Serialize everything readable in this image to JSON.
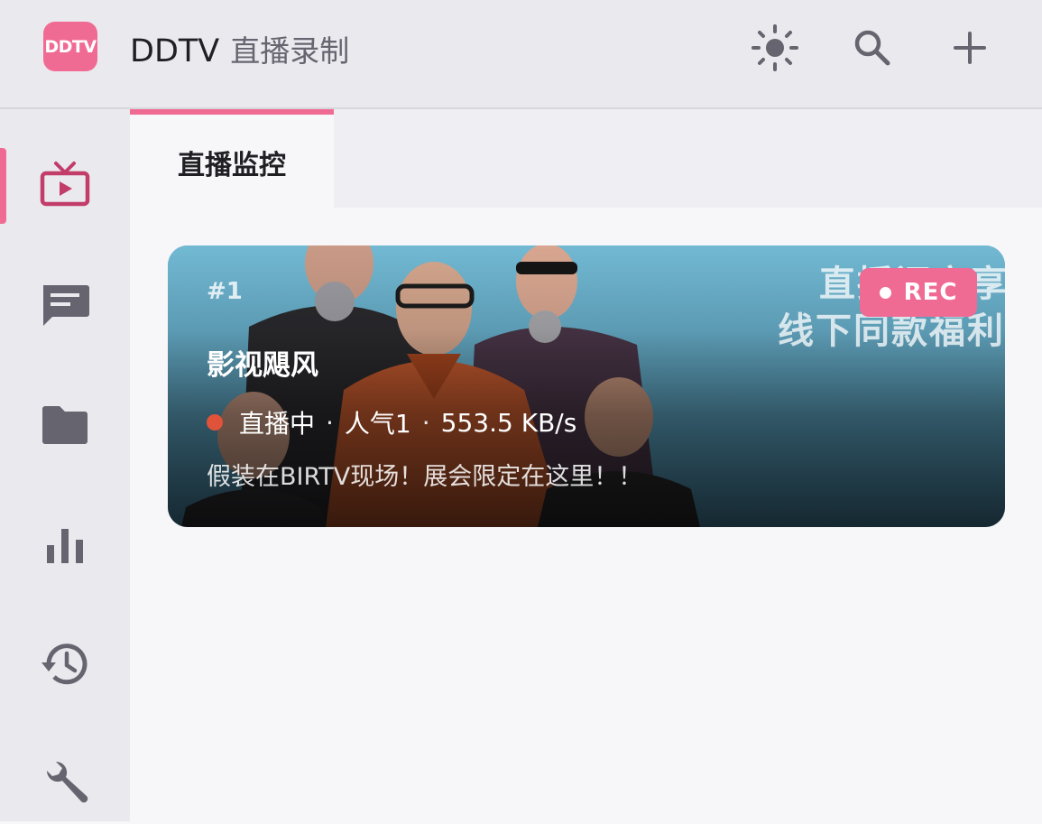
{
  "header": {
    "logo_text": "DDTV",
    "brand": "DDTV",
    "subtitle": "直播录制",
    "actions": [
      {
        "icon": "sun-icon",
        "name": "theme-toggle-button"
      },
      {
        "icon": "search-icon",
        "name": "search-button"
      },
      {
        "icon": "plus-icon",
        "name": "add-room-button"
      }
    ]
  },
  "sidebar": {
    "items": [
      {
        "icon": "tv-icon",
        "name": "sidebar-item-live",
        "active": true
      },
      {
        "icon": "message-icon",
        "name": "sidebar-item-danmaku",
        "active": false
      },
      {
        "icon": "folder-icon",
        "name": "sidebar-item-files",
        "active": false
      },
      {
        "icon": "bar-chart-icon",
        "name": "sidebar-item-stats",
        "active": false
      },
      {
        "icon": "history-icon",
        "name": "sidebar-item-history",
        "active": false
      },
      {
        "icon": "wrench-icon",
        "name": "sidebar-item-settings",
        "active": false
      }
    ]
  },
  "tabs": [
    {
      "label": "直播监控",
      "active": true
    }
  ],
  "rooms": [
    {
      "index": "#1",
      "name": "影视飓风",
      "status": "直播中",
      "popularity": "人气1",
      "speed": "553.5 KB/s",
      "title": "假装在BIRTV现场！展会限定在这里！！",
      "badge": "REC",
      "cover_text_line1": "直播间立享",
      "cover_text_line2": "线下同款福利"
    }
  ],
  "colors": {
    "accent": "#f06b94",
    "live_dot": "#e0533a",
    "header_bg": "#eae9ee",
    "icon_gray": "#66656f"
  }
}
